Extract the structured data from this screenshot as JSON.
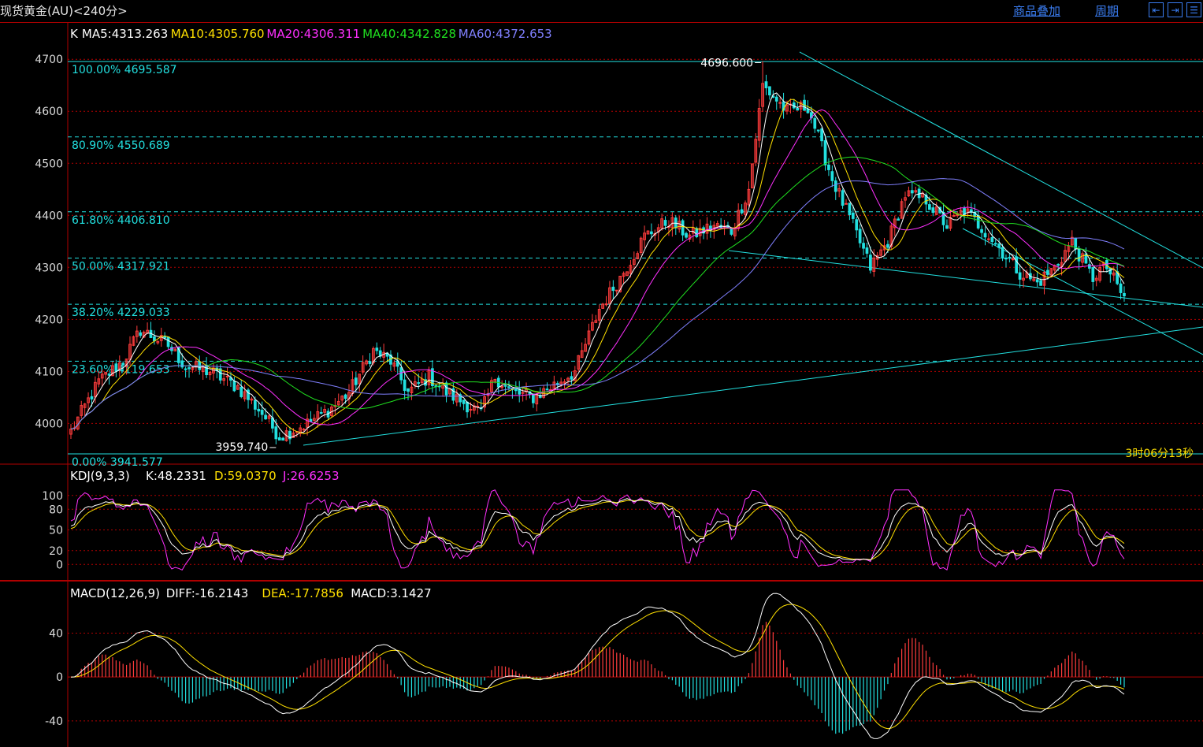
{
  "app": {
    "title": "现货黄金(AU)<240分>",
    "overlay_label": "商品叠加",
    "period_label": "周期",
    "nav_buttons": [
      "⇤",
      "⇥",
      "☰"
    ]
  },
  "colors": {
    "background": "#000000",
    "grid": "#b00000",
    "axis_text": "#dcdcdc",
    "up_candle": "#ff3c3c",
    "down_candle": "#22e0e0",
    "fib_line": "#22e0e0",
    "trend_line": "#22e0e0",
    "ma5": "#ffffff",
    "ma10": "#ffe000",
    "ma20": "#ff30ff",
    "ma40": "#20e020",
    "ma60": "#8080ff",
    "kdj_k": "#ffffff",
    "kdj_d": "#ffe000",
    "kdj_j": "#ff30ff",
    "macd_diff": "#ffffff",
    "macd_dea": "#ffe000",
    "hist_pos": "#ff3c3c",
    "hist_neg": "#22e0e0"
  },
  "price_panel": {
    "legend": [
      {
        "label": "K",
        "color": "#ffffff"
      },
      {
        "label": "MA5:4313.263",
        "color": "#ffffff"
      },
      {
        "label": "MA10:4305.760",
        "color": "#ffe000"
      },
      {
        "label": "MA20:4306.311",
        "color": "#ff30ff"
      },
      {
        "label": "MA40:4342.828",
        "color": "#20e020"
      },
      {
        "label": "MA60:4372.653",
        "color": "#8080ff"
      }
    ],
    "y_ticks": [
      4000,
      4100,
      4200,
      4300,
      4400,
      4500,
      4600,
      4700
    ],
    "y_range": [
      3940,
      4720
    ],
    "fib_levels": [
      {
        "label": "100.00% 4695.587",
        "value": 4695.587,
        "solid": true
      },
      {
        "label": "80.90% 4550.689",
        "value": 4550.689,
        "solid": false
      },
      {
        "label": "61.80% 4406.810",
        "value": 4406.81,
        "solid": false
      },
      {
        "label": "50.00% 4317.921",
        "value": 4317.921,
        "solid": false
      },
      {
        "label": "38.20% 4229.033",
        "value": 4229.033,
        "solid": false
      },
      {
        "label": "23.60% 4119.653",
        "value": 4119.653,
        "solid": false
      },
      {
        "label": "0.00% 3941.577",
        "value": 3941.577,
        "solid": true
      }
    ],
    "high_marker": {
      "label": "4696.600",
      "value": 4696.6,
      "bar": 199
    },
    "low_marker": {
      "label": "3959.740",
      "value": 3959.74,
      "bar": 59
    },
    "countdown": "3时06分13秒"
  },
  "kdj_panel": {
    "legend": [
      {
        "label": "KDJ(9,3,3)",
        "color": "#ffffff"
      },
      {
        "label": "K:48.2331",
        "color": "#ffffff"
      },
      {
        "label": "D:59.0370",
        "color": "#ffe000"
      },
      {
        "label": "J:26.6253",
        "color": "#ff30ff"
      }
    ],
    "y_ticks": [
      0,
      20,
      50,
      80,
      100
    ],
    "y_range": [
      -10,
      110
    ]
  },
  "macd_panel": {
    "legend": [
      {
        "label": "MACD(12,26,9)",
        "color": "#ffffff"
      },
      {
        "label": "DIFF:-16.2143",
        "color": "#ffffff"
      },
      {
        "label": "DEA:-17.7856",
        "color": "#ffe000"
      },
      {
        "label": "MACD:3.1427",
        "color": "#ffffff"
      }
    ],
    "y_ticks": [
      -40,
      0,
      40
    ],
    "y_range": [
      -58,
      64
    ]
  },
  "chart_data": {
    "type": "candlestick",
    "bars": 304,
    "close_anchors": [
      [
        0,
        3985
      ],
      [
        8,
        4080
      ],
      [
        15,
        4120
      ],
      [
        20,
        4180
      ],
      [
        28,
        4150
      ],
      [
        33,
        4110
      ],
      [
        40,
        4100
      ],
      [
        48,
        4070
      ],
      [
        55,
        4020
      ],
      [
        60,
        3975
      ],
      [
        68,
        4000
      ],
      [
        75,
        4030
      ],
      [
        80,
        4060
      ],
      [
        87,
        4140
      ],
      [
        92,
        4120
      ],
      [
        97,
        4060
      ],
      [
        103,
        4090
      ],
      [
        108,
        4060
      ],
      [
        113,
        4040
      ],
      [
        118,
        4020
      ],
      [
        122,
        4090
      ],
      [
        127,
        4060
      ],
      [
        133,
        4050
      ],
      [
        138,
        4070
      ],
      [
        145,
        4100
      ],
      [
        152,
        4220
      ],
      [
        158,
        4280
      ],
      [
        165,
        4360
      ],
      [
        172,
        4390
      ],
      [
        178,
        4360
      ],
      [
        185,
        4380
      ],
      [
        190,
        4370
      ],
      [
        195,
        4450
      ],
      [
        199,
        4650
      ],
      [
        206,
        4600
      ],
      [
        212,
        4610
      ],
      [
        219,
        4470
      ],
      [
        225,
        4380
      ],
      [
        230,
        4300
      ],
      [
        235,
        4350
      ],
      [
        240,
        4440
      ],
      [
        246,
        4430
      ],
      [
        252,
        4380
      ],
      [
        257,
        4410
      ],
      [
        263,
        4370
      ],
      [
        268,
        4330
      ],
      [
        273,
        4290
      ],
      [
        278,
        4270
      ],
      [
        283,
        4300
      ],
      [
        288,
        4350
      ],
      [
        292,
        4300
      ],
      [
        294,
        4280
      ],
      [
        296,
        4295
      ],
      [
        298,
        4300
      ],
      [
        303,
        4240
      ]
    ],
    "ma_final": {
      "MA5": 4313.263,
      "MA10": 4305.76,
      "MA20": 4306.311,
      "MA40": 4342.828,
      "MA60": 4372.653
    },
    "kdj_final": {
      "K": 48.2331,
      "D": 59.037,
      "J": 26.6253
    },
    "macd_final": {
      "DIFF": -16.2143,
      "DEA": -17.7856,
      "MACD": 3.1427
    }
  }
}
